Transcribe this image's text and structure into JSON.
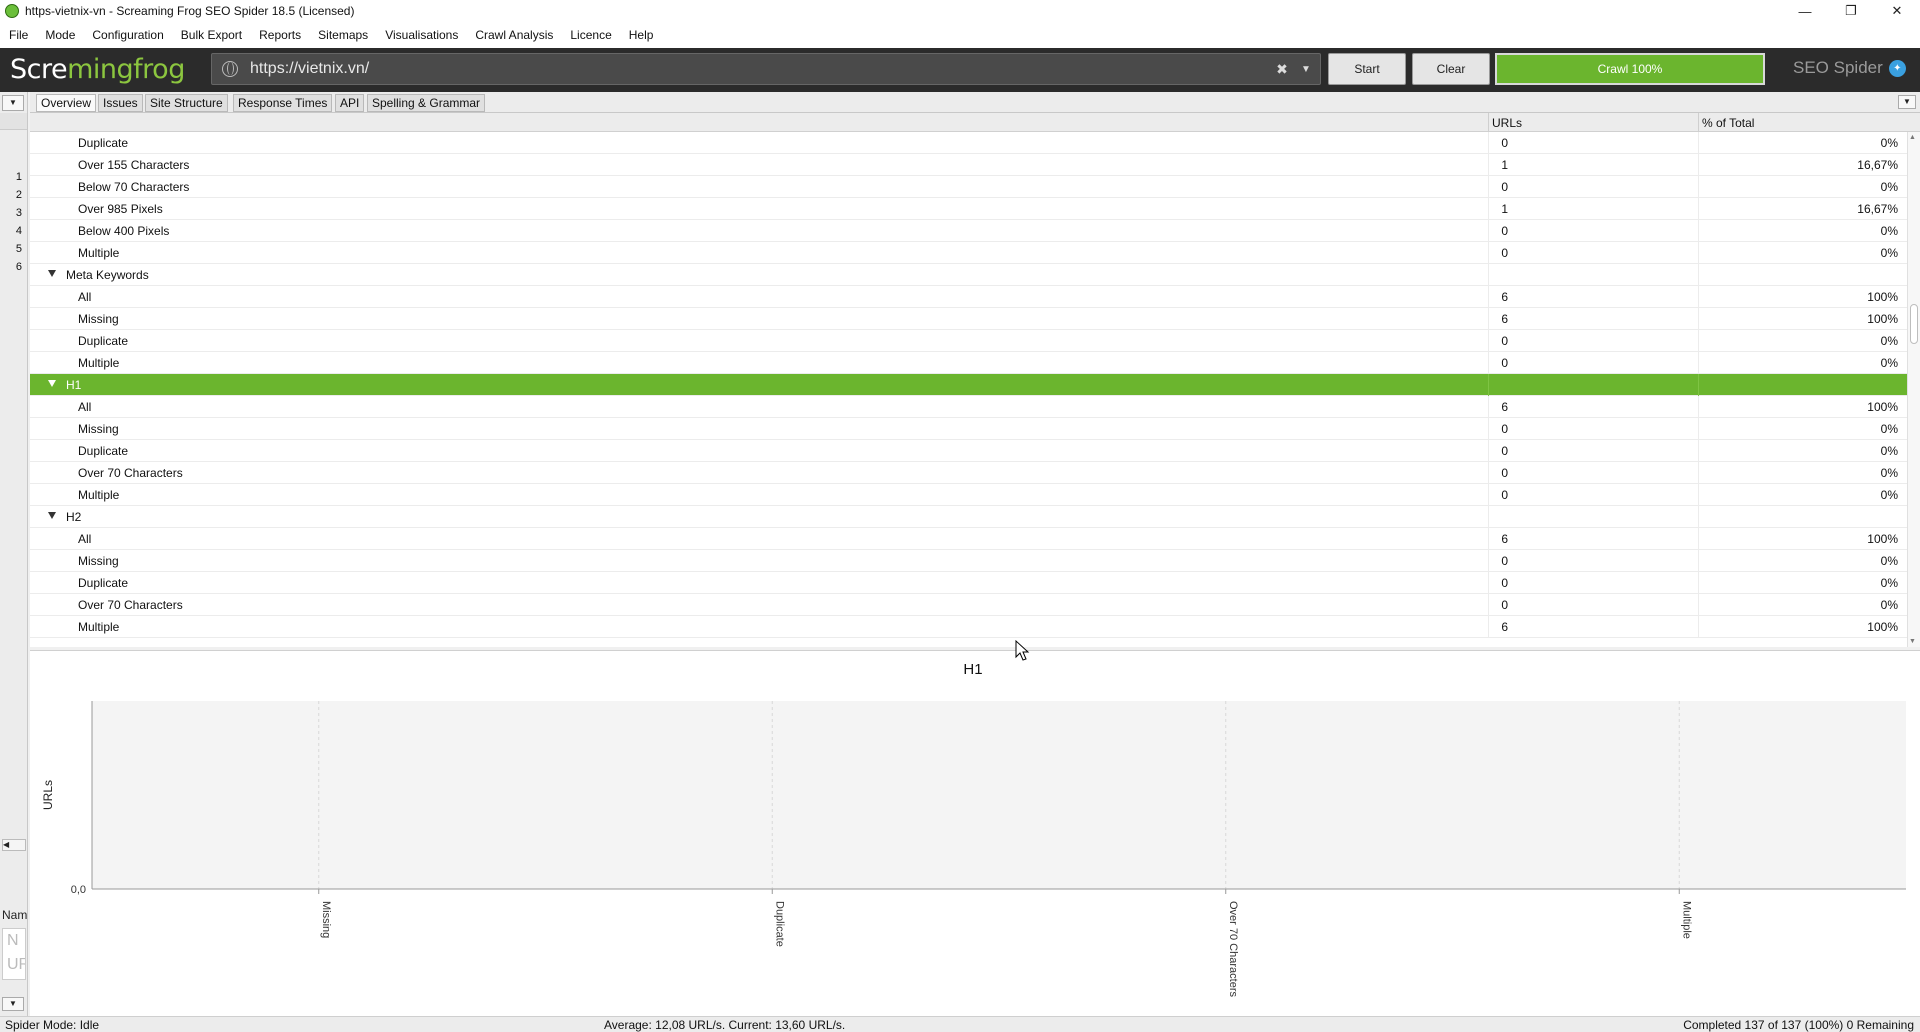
{
  "window": {
    "title": "https-vietnix-vn - Screaming Frog SEO Spider 18.5 (Licensed)",
    "controls": [
      "minimize",
      "restore",
      "close"
    ]
  },
  "menu": [
    "File",
    "Mode",
    "Configuration",
    "Bulk Export",
    "Reports",
    "Sitemaps",
    "Visualisations",
    "Crawl Analysis",
    "Licence",
    "Help"
  ],
  "toolbar": {
    "logo_part1": "Scre",
    "logo_part2": "mingfrog",
    "url": "https://vietnix.vn/",
    "start_label": "Start",
    "clear_label": "Clear",
    "crawl_label": "Crawl 100%",
    "crawl_progress": 1.0,
    "brand": "SEO Spider"
  },
  "tabs": [
    "Overview",
    "Issues",
    "Site Structure",
    "Response Times",
    "API",
    "Spelling & Grammar"
  ],
  "active_tab": "Overview",
  "table": {
    "columns": [
      "",
      "URLs",
      "% of Total"
    ],
    "rows": [
      {
        "label": "Duplicate",
        "urls": "0",
        "pct": "0%",
        "level": 1
      },
      {
        "label": "Over 155 Characters",
        "urls": "1",
        "pct": "16,67%",
        "level": 1
      },
      {
        "label": "Below 70 Characters",
        "urls": "0",
        "pct": "0%",
        "level": 1
      },
      {
        "label": "Over 985 Pixels",
        "urls": "1",
        "pct": "16,67%",
        "level": 1
      },
      {
        "label": "Below 400 Pixels",
        "urls": "0",
        "pct": "0%",
        "level": 1
      },
      {
        "label": "Multiple",
        "urls": "0",
        "pct": "0%",
        "level": 1
      },
      {
        "label": "Meta Keywords",
        "urls": "",
        "pct": "",
        "level": 0
      },
      {
        "label": "All",
        "urls": "6",
        "pct": "100%",
        "level": 1
      },
      {
        "label": "Missing",
        "urls": "6",
        "pct": "100%",
        "level": 1
      },
      {
        "label": "Duplicate",
        "urls": "0",
        "pct": "0%",
        "level": 1
      },
      {
        "label": "Multiple",
        "urls": "0",
        "pct": "0%",
        "level": 1
      },
      {
        "label": "H1",
        "urls": "",
        "pct": "",
        "level": 0,
        "selected": true
      },
      {
        "label": "All",
        "urls": "6",
        "pct": "100%",
        "level": 1
      },
      {
        "label": "Missing",
        "urls": "0",
        "pct": "0%",
        "level": 1
      },
      {
        "label": "Duplicate",
        "urls": "0",
        "pct": "0%",
        "level": 1
      },
      {
        "label": "Over 70 Characters",
        "urls": "0",
        "pct": "0%",
        "level": 1
      },
      {
        "label": "Multiple",
        "urls": "0",
        "pct": "0%",
        "level": 1
      },
      {
        "label": "H2",
        "urls": "",
        "pct": "",
        "level": 0
      },
      {
        "label": "All",
        "urls": "6",
        "pct": "100%",
        "level": 1
      },
      {
        "label": "Missing",
        "urls": "0",
        "pct": "0%",
        "level": 1
      },
      {
        "label": "Duplicate",
        "urls": "0",
        "pct": "0%",
        "level": 1
      },
      {
        "label": "Over 70 Characters",
        "urls": "0",
        "pct": "0%",
        "level": 1
      },
      {
        "label": "Multiple",
        "urls": "6",
        "pct": "100%",
        "level": 1
      }
    ]
  },
  "line_numbers": [
    "1",
    "2",
    "3",
    "4",
    "5",
    "6"
  ],
  "left_panel": {
    "label": "Nam",
    "placeholder_1": "N",
    "placeholder_2": "UR"
  },
  "chart_data": {
    "type": "bar",
    "title": "H1",
    "ylabel": "URLs",
    "xlabel": "",
    "categories": [
      "Missing",
      "Duplicate",
      "Over 70 Characters",
      "Multiple"
    ],
    "values": [
      0,
      0,
      0,
      0
    ],
    "ytick_labels": [
      "0,0"
    ],
    "grid": true
  },
  "status": {
    "mode": "Spider Mode: Idle",
    "average": "Average: 12,08 URL/s. Current: 13,60 URL/s.",
    "completed": "Completed 137 of 137 (100%) 0 Remaining"
  },
  "colors": {
    "accent_green": "#6bb52e",
    "toolbar_dark": "#2b2b2b"
  }
}
